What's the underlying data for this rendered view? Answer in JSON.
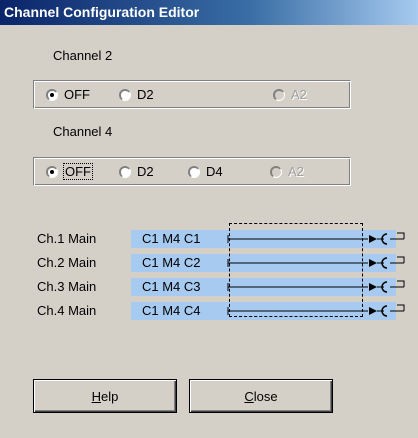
{
  "window": {
    "title": "Channel Configuration Editor"
  },
  "channel2": {
    "label": "Channel 2",
    "options": [
      {
        "label": "OFF",
        "selected": true,
        "enabled": true
      },
      {
        "label": "D2",
        "selected": false,
        "enabled": true
      },
      {
        "label": "A2",
        "selected": false,
        "enabled": false
      }
    ]
  },
  "channel4": {
    "label": "Channel 4",
    "options": [
      {
        "label": "OFF",
        "selected": true,
        "enabled": true,
        "focused": true
      },
      {
        "label": "D2",
        "selected": false,
        "enabled": true
      },
      {
        "label": "D4",
        "selected": false,
        "enabled": true
      },
      {
        "label": "A2",
        "selected": false,
        "enabled": false
      }
    ]
  },
  "routing": {
    "rows": [
      {
        "name": "Ch.1 Main",
        "value": "C1 M4 C1"
      },
      {
        "name": "Ch.2 Main",
        "value": "C1 M4 C2"
      },
      {
        "name": "Ch.3 Main",
        "value": "C1 M4 C3"
      },
      {
        "name": "Ch.4 Main",
        "value": "C1 M4 C4"
      }
    ]
  },
  "buttons": {
    "help_prefix": "",
    "help_key": "H",
    "help_rest": "elp",
    "close_key": "C",
    "close_rest": "lose"
  },
  "colors": {
    "title_start": "#0a246a",
    "title_end": "#a6caf0",
    "route_fill": "#a6caf0",
    "face": "#d4d0c8"
  }
}
